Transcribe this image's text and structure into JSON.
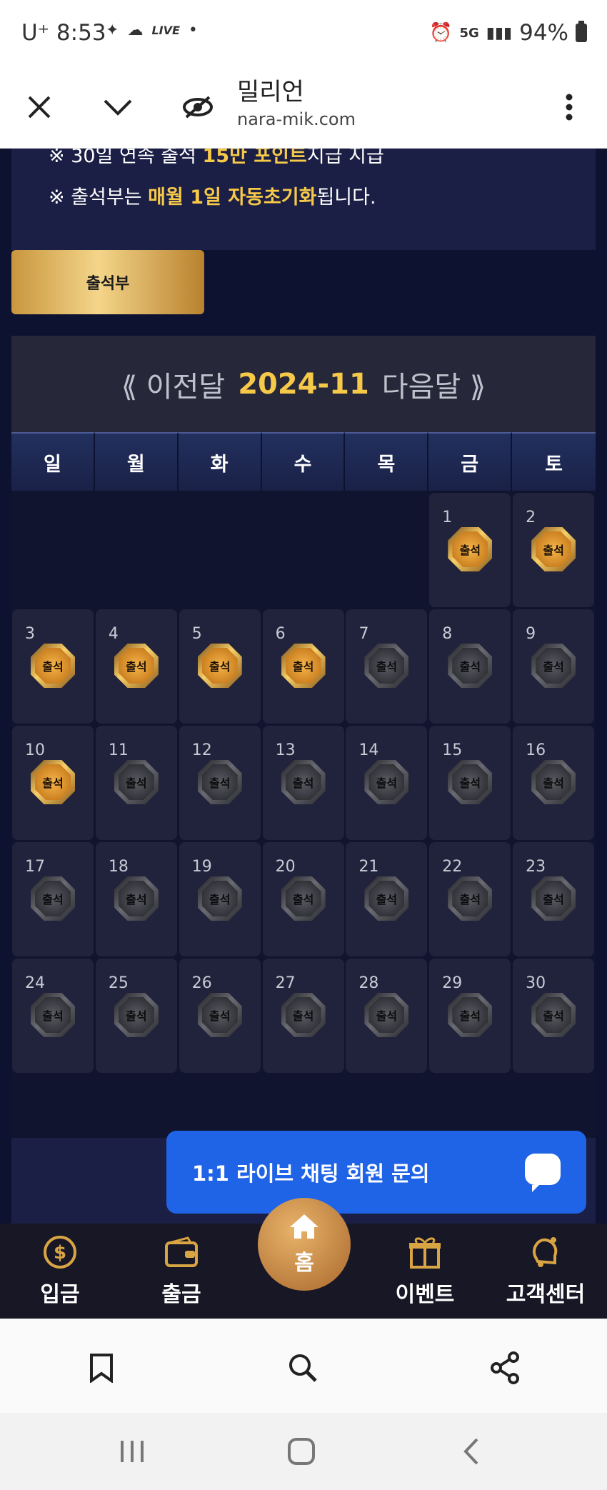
{
  "status_bar": {
    "time": "8:53",
    "carrier": "U⁺",
    "live_label": "LIVE",
    "network": "5G",
    "battery": "94%"
  },
  "browser": {
    "title": "밀리언",
    "url": "nara-mik.com"
  },
  "notice": {
    "line1_pre": "※ 30일 연속 출석 ",
    "line1_hl": "15만 포인트",
    "line1_post": "지급 지급",
    "line2_pre": "※ 출석부는 ",
    "line2_hl": "매월 1일 자동초기화",
    "line2_post": "됩니다."
  },
  "tab_label": "출석부",
  "calendar": {
    "prev_label": "⟪ 이전달",
    "month": "2024-11",
    "next_label": "다음달 ⟫",
    "weekdays": [
      "일",
      "월",
      "화",
      "수",
      "목",
      "금",
      "토"
    ],
    "badge_label": "출석",
    "first_weekday_index": 5,
    "days_in_month": 30,
    "attended_days": [
      1,
      2,
      3,
      4,
      5,
      6,
      10
    ]
  },
  "chat_label": "1:1 라이브 채팅 회원 문의",
  "bottom_nav": {
    "deposit": "입금",
    "withdraw": "출금",
    "home": "홈",
    "event": "이벤트",
    "support": "고객센터"
  }
}
